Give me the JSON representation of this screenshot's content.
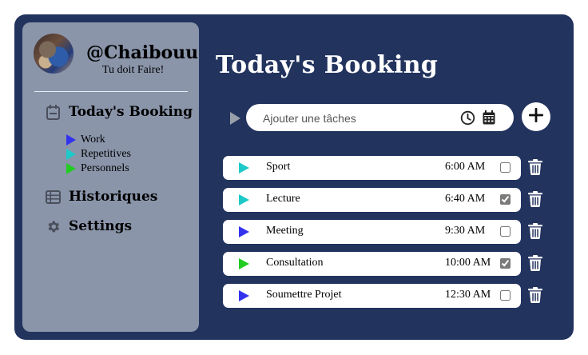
{
  "sidebar": {
    "username": "@Chaibouu",
    "tagline": "Tu doit Faire!",
    "nav": [
      {
        "label": "Today's Booking",
        "icon": "calendar-icon"
      },
      {
        "label": "Historiques",
        "icon": "table-list-icon"
      },
      {
        "label": "Settings",
        "icon": "gear-icon"
      }
    ],
    "categories": [
      {
        "label": "Work",
        "color": "#3333ee"
      },
      {
        "label": "Repetitives",
        "color": "#1ec9c9"
      },
      {
        "label": "Personnels",
        "color": "#22cc22"
      }
    ]
  },
  "main": {
    "title": "Today's Booking",
    "add_task": {
      "placeholder": "Ajouter une tâches",
      "icons": [
        "play-icon",
        "clock-icon",
        "calendar-icon",
        "plus-icon"
      ]
    },
    "tasks": [
      {
        "name": "Sport",
        "time": "6:00 AM",
        "checked": false,
        "color": "#1ec9c9"
      },
      {
        "name": "Lecture",
        "time": "6:40 AM",
        "checked": true,
        "color": "#1ec9c9"
      },
      {
        "name": "Meeting",
        "time": "9:30 AM",
        "checked": false,
        "color": "#3333ee"
      },
      {
        "name": "Consultation",
        "time": "10:00 AM",
        "checked": true,
        "color": "#22cc22"
      },
      {
        "name": "Soumettre Projet",
        "time": "12:30 AM",
        "checked": false,
        "color": "#3333ee"
      }
    ]
  },
  "colors": {
    "background": "#22335e",
    "sidebar": "#8a95aa"
  }
}
